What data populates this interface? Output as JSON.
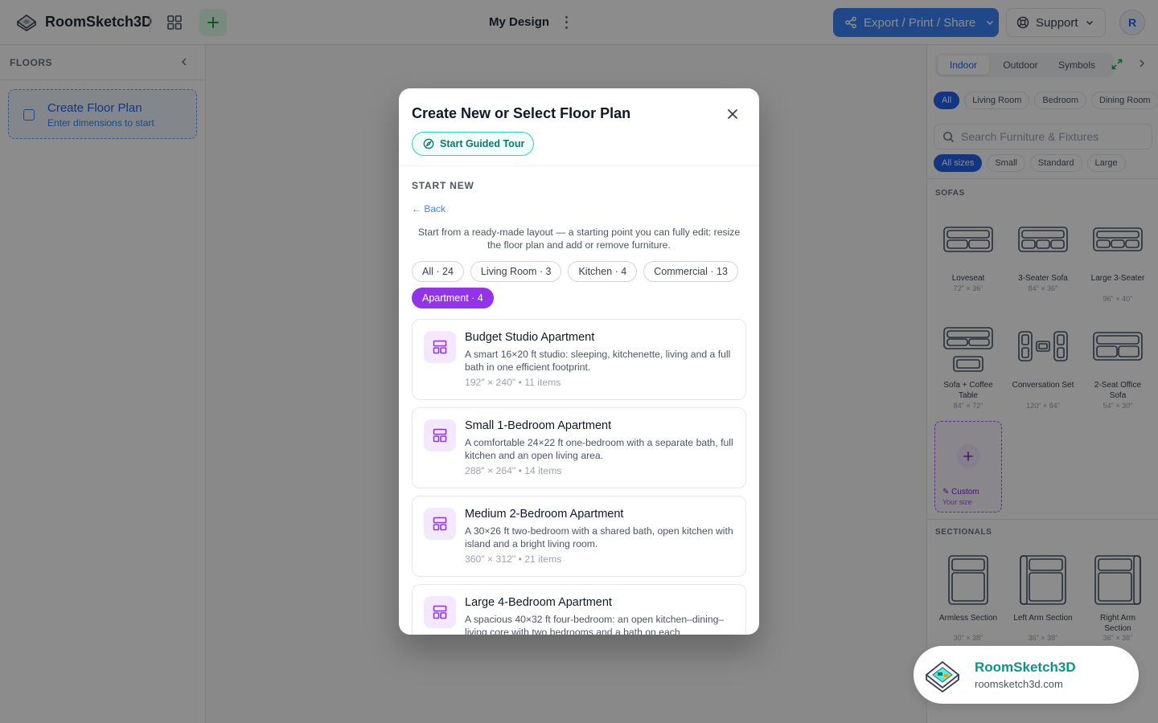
{
  "header": {
    "app_title": "RoomSketch3D",
    "design_name": "My Design",
    "export_label": "Export / Print / Share",
    "support_label": "Support",
    "avatar_initial": "R"
  },
  "left_sidebar": {
    "title": "FLOORS",
    "create_card": {
      "title": "Create Floor Plan",
      "subtitle": "Enter dimensions to start"
    }
  },
  "right_panel": {
    "tabs": [
      "Indoor",
      "Outdoor",
      "Symbols"
    ],
    "room_filters": [
      "All",
      "Living Room",
      "Bedroom",
      "Dining Room"
    ],
    "search_placeholder": "Search Furniture & Fixtures",
    "size_filters": [
      "All sizes",
      "Small",
      "Standard",
      "Large"
    ],
    "sections": [
      {
        "label": "SOFAS",
        "items": [
          {
            "name": "Loveseat",
            "dims": "72\" × 36\""
          },
          {
            "name": "3-Seater Sofa",
            "dims": "84\" × 36\""
          },
          {
            "name": "Large 3-Seater",
            "dims": "96\" × 40\""
          },
          {
            "name": "Sofa + Coffee Table",
            "dims": "84\" × 72\""
          },
          {
            "name": "Conversation Set",
            "dims": "120\" × 84\""
          },
          {
            "name": "2-Seat Office Sofa",
            "dims": "54\" × 30\""
          }
        ]
      },
      {
        "label": "SECTIONALS",
        "items": [
          {
            "name": "Armless Section",
            "dims": "30\" × 38\""
          },
          {
            "name": "Left Arm Section",
            "dims": "36\" × 38\""
          },
          {
            "name": "Right Arm Section",
            "dims": "36\" × 38\""
          }
        ]
      }
    ],
    "custom": {
      "label": "Custom",
      "sublabel": "Your size"
    }
  },
  "modal": {
    "title": "Create New or Select Floor Plan",
    "tour_label": "Start Guided Tour",
    "section_label": "START NEW",
    "back_label": "← Back",
    "intro": "Start from a ready-made layout — a starting point you can fully edit: resize the floor plan and add or remove furniture.",
    "filters": [
      {
        "label": "All · 24",
        "active": false
      },
      {
        "label": "Living Room · 3",
        "active": false
      },
      {
        "label": "Kitchen · 4",
        "active": false
      },
      {
        "label": "Commercial · 13",
        "active": false
      },
      {
        "label": "Apartment · 4",
        "active": true
      }
    ],
    "templates": [
      {
        "name": "Budget Studio Apartment",
        "desc": "A smart 16×20 ft studio: sleeping, kitchenette, living and a full bath in one efficient footprint.",
        "meta": "192\" × 240\" • 11 items"
      },
      {
        "name": "Small 1-Bedroom Apartment",
        "desc": "A comfortable 24×22 ft one-bedroom with a separate bath, full kitchen and an open living area.",
        "meta": "288\" × 264\" • 14 items"
      },
      {
        "name": "Medium 2-Bedroom Apartment",
        "desc": "A 30×26 ft two-bedroom with a shared bath, open kitchen with island and a bright living room.",
        "meta": "360\" × 312\" • 21 items"
      },
      {
        "name": "Large 4-Bedroom Apartment",
        "desc": "A spacious 40×32 ft four-bedroom: an open kitchen–dining–living core with two bedrooms and a bath on each",
        "meta": ""
      }
    ]
  },
  "promo": {
    "name": "RoomSketch3D",
    "url": "roomsketch3d.com"
  },
  "colors": {
    "accent": "#3b82f6",
    "purple": "#9333ea",
    "teal": "#0d9488"
  }
}
